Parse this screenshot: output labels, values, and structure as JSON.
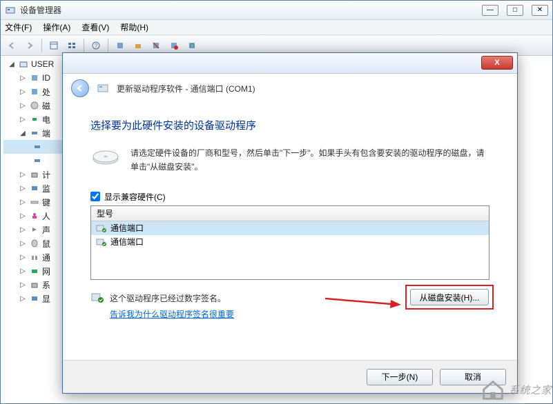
{
  "window": {
    "title": "设备管理器",
    "menu": {
      "file": "文件(F)",
      "action": "操作(A)",
      "view": "查看(V)",
      "help": "帮助(H)"
    },
    "controls": {
      "min": "—",
      "max": "□",
      "close": "✕"
    }
  },
  "tree": {
    "root": "USER",
    "nodes": [
      "ID",
      "处",
      "磁",
      "电",
      "端",
      "计",
      "监",
      "键",
      "人",
      "声",
      "鼠",
      "通",
      "网",
      "系",
      "显"
    ],
    "port_children": [
      "",
      ""
    ]
  },
  "dialog": {
    "title": "更新驱动程序软件 - 通信端口 (COM1)",
    "heading": "选择要为此硬件安装的设备驱动程序",
    "instruction": "请选定硬件设备的厂商和型号，然后单击\"下一步\"。如果手头有包含要安装的驱动程序的磁盘，请单击\"从磁盘安装\"。",
    "show_compatible_label": "显示兼容硬件(C)",
    "list_header": "型号",
    "list_items": [
      "通信端口",
      "通信端口"
    ],
    "signature_text": "这个驱动程序已经过数字签名。",
    "signature_link": "告诉我为什么驱动程序签名很重要",
    "disk_install_btn": "从磁盘安装(H)...",
    "next_btn": "下一步(N)",
    "cancel_btn": "取消",
    "close_x": "X"
  },
  "watermark": "系统之家"
}
